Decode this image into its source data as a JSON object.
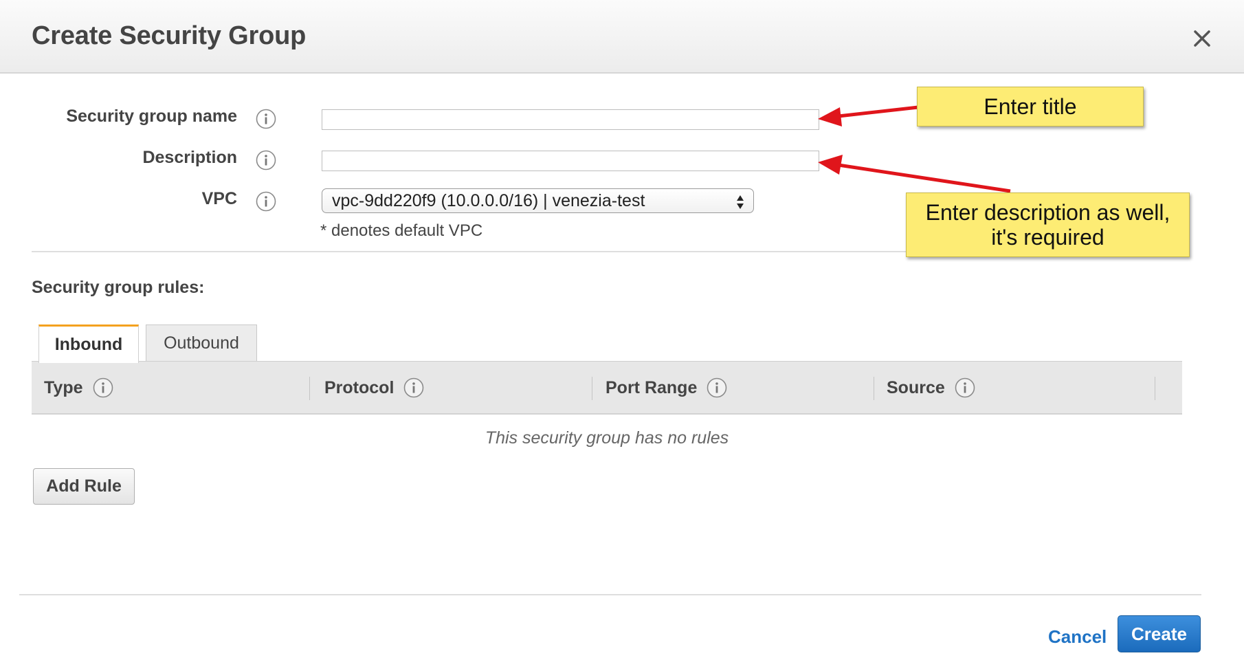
{
  "dialog": {
    "title": "Create Security Group",
    "close_icon": "close-icon"
  },
  "form": {
    "name_label": "Security group name",
    "name_value": "",
    "description_label": "Description",
    "description_value": "",
    "vpc_label": "VPC",
    "vpc_selected": "vpc-9dd220f9 (10.0.0.0/16) | venezia-test",
    "vpc_note": "* denotes default VPC",
    "info_icon": "info-icon"
  },
  "rules": {
    "section_title": "Security group rules:",
    "tabs": [
      {
        "label": "Inbound",
        "active": true
      },
      {
        "label": "Outbound",
        "active": false
      }
    ],
    "columns": [
      "Type",
      "Protocol",
      "Port Range",
      "Source"
    ],
    "empty_text": "This security group has no rules",
    "add_rule_label": "Add Rule"
  },
  "footer": {
    "cancel_label": "Cancel",
    "create_label": "Create"
  },
  "annotations": {
    "title_note": "Enter title",
    "description_note": "Enter description as well, it's required",
    "note_color": "#fdec74",
    "arrow_color": "#e0151b"
  },
  "colors": {
    "active_tab_accent": "#f4a11e",
    "primary_button": "#1b6bbc",
    "link": "#1f73c5"
  }
}
